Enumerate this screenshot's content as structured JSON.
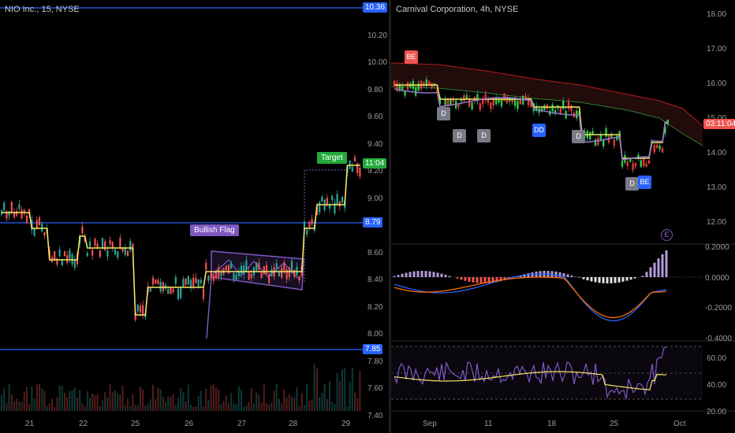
{
  "left_chart": {
    "title": "NIO Inc., 15, NYSE",
    "price_ticks": [
      "10.40",
      "10.20",
      "10.00",
      "9.80",
      "9.60",
      "9.40",
      "9.20",
      "9.00",
      "8.80",
      "8.60",
      "8.40",
      "8.20",
      "8.00",
      "7.80",
      "7.60",
      "7.40"
    ],
    "badges": {
      "top": "10.36",
      "current": "11:04",
      "mid": "8.79",
      "low": "7.85"
    },
    "labels": {
      "target": "Target",
      "flag": "Bullish Flag"
    },
    "time_ticks": [
      "21",
      "22",
      "25",
      "26",
      "27",
      "28",
      "29"
    ],
    "colors": {
      "line": "#2962ff",
      "ma": "#f5e663",
      "flag": "#7e57c2",
      "up": "#26a69a",
      "down": "#ef5350",
      "badge_green": "#22ab3c"
    }
  },
  "right_chart": {
    "title": "Carnival Corporation, 4h, NYSE",
    "price_ticks": [
      "18.00",
      "17.00",
      "16.00",
      "15.00",
      "14.00",
      "13.00",
      "12.00"
    ],
    "current_badge": "03:11:04",
    "macd_ticks": [
      "0.2000",
      "0.0000",
      "-0.2000",
      "-0.4000"
    ],
    "rsi_ticks": [
      "60.00",
      "40.00",
      "20.00"
    ],
    "time_ticks": [
      "Sep",
      "11",
      "18",
      "25",
      "Oct"
    ],
    "signals": [
      {
        "text": "BE",
        "color": "#ef5350"
      },
      {
        "text": "D",
        "color": "#787b86"
      },
      {
        "text": "D",
        "color": "#787b86"
      },
      {
        "text": "D",
        "color": "#787b86"
      },
      {
        "text": "DD",
        "color": "#2962ff"
      },
      {
        "text": "D",
        "color": "#787b86"
      },
      {
        "text": "D",
        "color": "#787b86"
      },
      {
        "text": "BE",
        "color": "#2962ff"
      },
      {
        "text": "BE",
        "color": "#2962ff"
      }
    ],
    "earnings_marker": "E"
  }
}
